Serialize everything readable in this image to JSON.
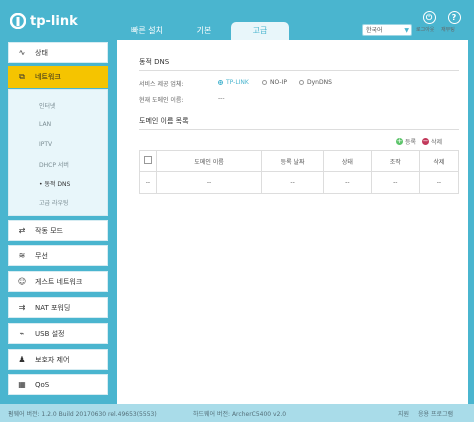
{
  "brand": {
    "name": "tp-link"
  },
  "nav": {
    "tabs": [
      {
        "label": "빠른 설치"
      },
      {
        "label": "기본"
      },
      {
        "label": "고급"
      }
    ],
    "language": "한국어",
    "logout_label": "로그아웃",
    "reboot_label": "재부팅"
  },
  "sidebar": {
    "items": [
      {
        "label": "상태",
        "icon": "pulse-icon"
      },
      {
        "label": "네트워크",
        "icon": "network-icon"
      },
      {
        "label": "작동 모드",
        "icon": "mode-icon"
      },
      {
        "label": "무선",
        "icon": "wifi-icon"
      },
      {
        "label": "게스트 네트워크",
        "icon": "guest-icon"
      },
      {
        "label": "NAT 포워딩",
        "icon": "nat-icon"
      },
      {
        "label": "USB 설정",
        "icon": "usb-icon"
      },
      {
        "label": "보호자 제어",
        "icon": "parental-icon"
      },
      {
        "label": "QoS",
        "icon": "qos-icon"
      }
    ],
    "network_sub": [
      "인터넷",
      "LAN",
      "IPTV",
      "DHCP 서버",
      "동적 DNS",
      "고급 라우팅"
    ]
  },
  "ddns": {
    "title": "동적 DNS",
    "provider_label": "서비스 제공 업체:",
    "providers": [
      "TP-LINK",
      "NO-IP",
      "DynDNS"
    ],
    "current_domain_label": "현재 도메인 이름:",
    "current_domain_value": "---"
  },
  "domain_list": {
    "title": "도메인 이름 목록",
    "add_label": "등록",
    "delete_label": "삭제",
    "columns": [
      "도메인 이름",
      "등록 날짜",
      "상태",
      "조작",
      "삭제"
    ],
    "row": [
      "--",
      "--",
      "--",
      "--",
      "--",
      "--"
    ]
  },
  "footer": {
    "firmware": "펌웨어 버전: 1.2.0 Build 20170630 rel.49653(5553)",
    "hardware": "하드웨어 버전: ArcherC5400 v2.0",
    "support_label": "지원",
    "app_label": "응용 프로그램"
  },
  "colors": {
    "accent": "#4ab5cf",
    "active_menu": "#f5c400"
  }
}
